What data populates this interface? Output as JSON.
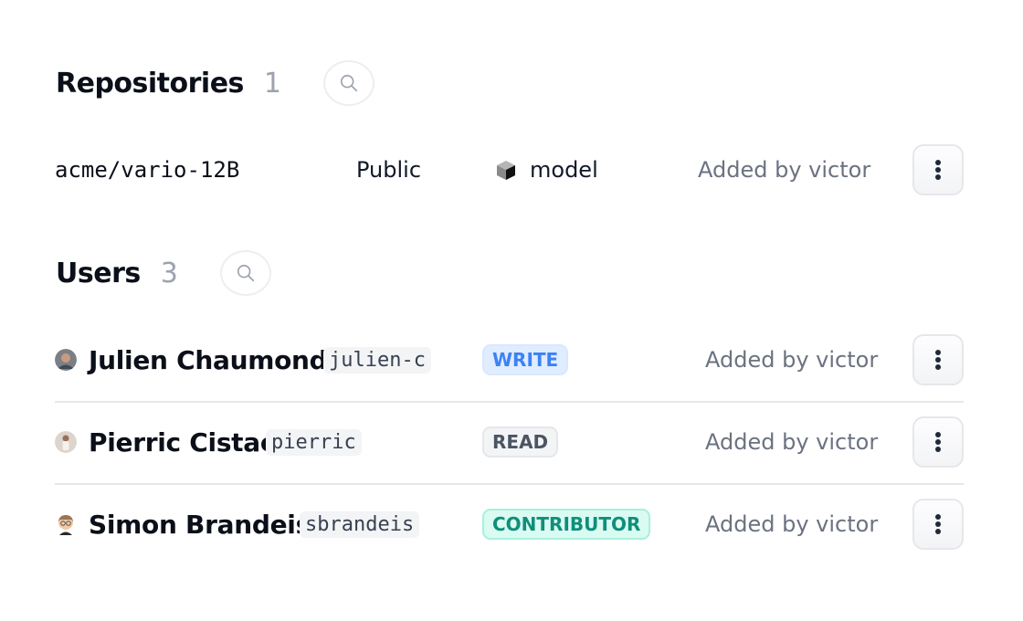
{
  "repositories": {
    "title": "Repositories",
    "count": "1",
    "search_icon": "search-icon",
    "items": [
      {
        "name": "acme/vario-12B",
        "visibility": "Public",
        "type_icon": "cube-icon",
        "type": "model",
        "added_by": "Added by victor",
        "menu_icon": "more-vertical-icon"
      }
    ]
  },
  "users": {
    "title": "Users",
    "count": "3",
    "search_icon": "search-icon",
    "items": [
      {
        "name": "Julien Chaumond",
        "handle": "julien-c",
        "role": "WRITE",
        "added_by": "Added by victor",
        "menu_icon": "more-vertical-icon"
      },
      {
        "name": "Pierric Cistac",
        "handle": "pierric",
        "role": "READ",
        "added_by": "Added by victor",
        "menu_icon": "more-vertical-icon"
      },
      {
        "name": "Simon Brandeis",
        "handle": "sbrandeis",
        "role": "CONTRIBUTOR",
        "added_by": "Added by victor",
        "menu_icon": "more-vertical-icon"
      }
    ]
  },
  "colors": {
    "write_badge": "#3b82f6",
    "read_badge": "#4b5563",
    "contributor_badge": "#0f8f7a",
    "muted_text": "#6b7280",
    "count_text": "#9ca3af"
  }
}
